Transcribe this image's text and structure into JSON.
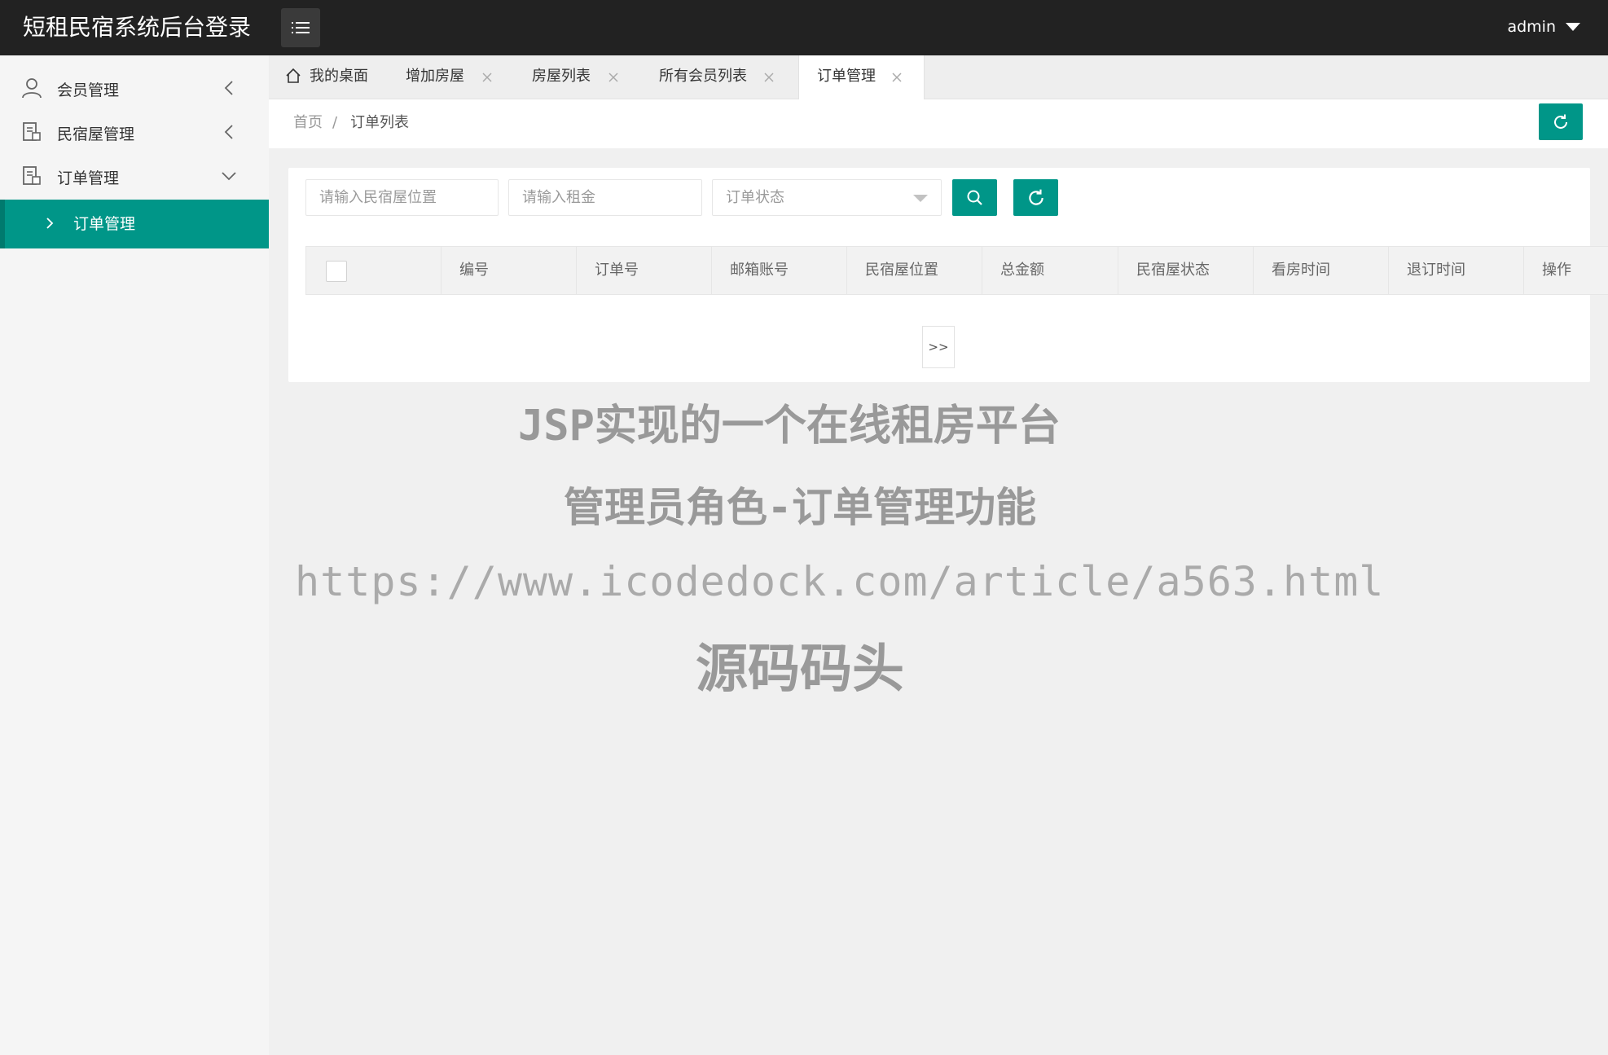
{
  "header": {
    "app_title": "短租民宿系统后台登录",
    "user_name": "admin"
  },
  "sidebar": {
    "items": [
      {
        "label": "会员管理",
        "icon": "user-icon",
        "state": "collapsed"
      },
      {
        "label": "民宿屋管理",
        "icon": "building-icon",
        "state": "collapsed"
      },
      {
        "label": "订单管理",
        "icon": "building-icon",
        "state": "expanded"
      }
    ],
    "sub_items": [
      {
        "label": "订单管理",
        "active": true
      }
    ]
  },
  "tabs": [
    {
      "label": "我的桌面",
      "icon": "home-icon",
      "closable": false
    },
    {
      "label": "增加房屋",
      "closable": true
    },
    {
      "label": "房屋列表",
      "closable": true
    },
    {
      "label": "所有会员列表",
      "closable": true
    },
    {
      "label": "订单管理",
      "closable": true,
      "active": true
    }
  ],
  "breadcrumb": {
    "home": "首页",
    "separator": "/",
    "current": "订单列表"
  },
  "filters": {
    "location_placeholder": "请输入民宿屋位置",
    "rent_placeholder": "请输入租金",
    "status_placeholder": "订单状态"
  },
  "table": {
    "columns": [
      "编号",
      "订单号",
      "邮箱账号",
      "民宿屋位置",
      "总金额",
      "民宿屋状态",
      "看房时间",
      "退订时间",
      "操作"
    ],
    "rows": []
  },
  "pager": {
    "next_label": ">>"
  },
  "watermark": {
    "line1": "JSP实现的一个在线租房平台",
    "line2": "管理员角色-订单管理功能",
    "line3": "https://www.icodedock.com/article/a563.html",
    "line4": "源码码头"
  },
  "colors": {
    "header_bg": "#222222",
    "accent": "#009688",
    "page_bg": "#f0f0f0"
  }
}
